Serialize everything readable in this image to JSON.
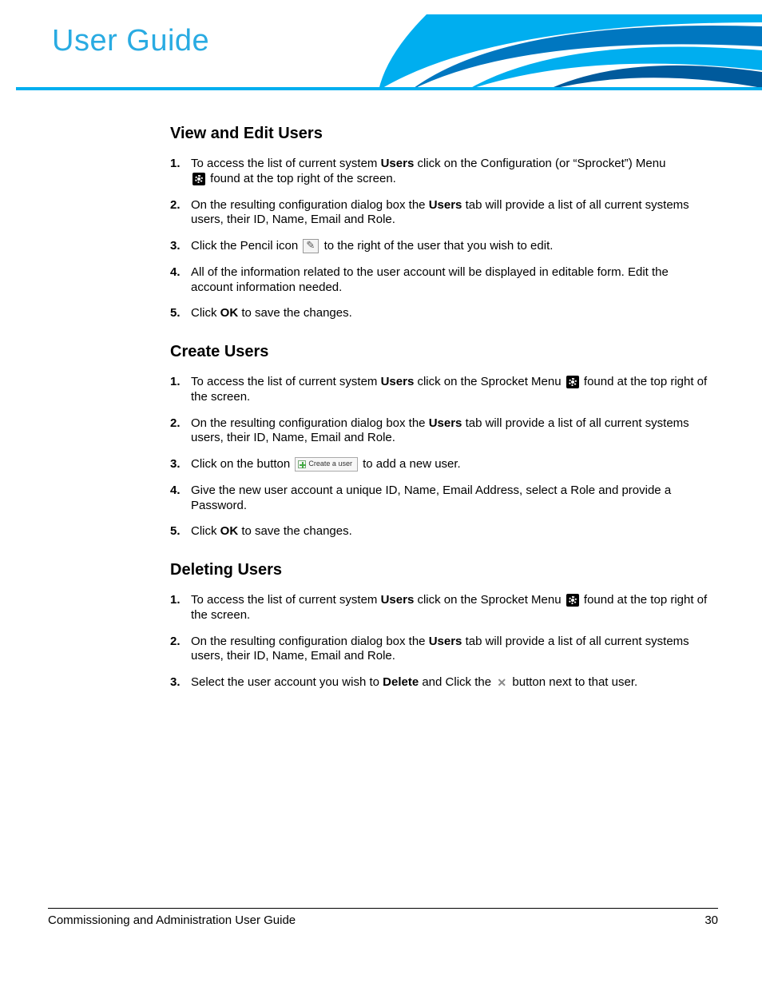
{
  "header": {
    "title": "User Guide"
  },
  "sections": {
    "view_edit": {
      "heading": "View and Edit Users",
      "items": {
        "n1": "1.",
        "n2": "2.",
        "n3": "3.",
        "n4": "4.",
        "n5": "5.",
        "i1a": "To access the list of current system ",
        "i1b": "Users",
        "i1c": " click on the Configuration (or “Sprocket”) Menu ",
        "i1d": " found at the top right of the screen.",
        "i2a": "On the resulting configuration dialog box the ",
        "i2b": "Users",
        "i2c": " tab will provide a list of all current systems users, their ID, Name, Email and Role.",
        "i3a": "Click the Pencil icon ",
        "i3b": " to the right of the user that you wish to edit.",
        "i4": "All of the information related to the user account will be displayed in editable form. Edit the account information needed.",
        "i5a": "Click ",
        "i5b": "OK",
        "i5c": " to save the changes."
      }
    },
    "create": {
      "heading": "Create Users",
      "items": {
        "n1": "1.",
        "n2": "2.",
        "n3": "3.",
        "n4": "4.",
        "n5": "5.",
        "i1a": "To access the list of current system ",
        "i1b": "Users",
        "i1c": " click on the Sprocket Menu ",
        "i1d": " found at the top right of the screen.",
        "i2a": "On the resulting configuration dialog box the ",
        "i2b": "Users",
        "i2c": " tab will provide a list of all current systems users, their ID, Name, Email and Role.",
        "i3a": "Click on the button ",
        "i3btn": "Create a user",
        "i3b": " to add a new user.",
        "i4": "Give the new user account a unique ID, Name, Email Address, select a Role and provide a Password.",
        "i5a": "Click ",
        "i5b": "OK",
        "i5c": " to save the changes."
      }
    },
    "delete": {
      "heading": "Deleting Users",
      "items": {
        "n1": "1.",
        "n2": "2.",
        "n3": "3.",
        "i1a": "To access the list of current system ",
        "i1b": "Users",
        "i1c": " click on the Sprocket Menu ",
        "i1d": " found at the top right of the screen.",
        "i2a": "On the resulting configuration dialog box the ",
        "i2b": "Users",
        "i2c": " tab will provide a list of all current systems users, their ID, Name, Email and Role.",
        "i3a": "Select the user account you wish to ",
        "i3b": "Delete",
        "i3c": " and Click the ",
        "i3d": " button next to that user."
      }
    }
  },
  "footer": {
    "left": "Commissioning and Administration User Guide",
    "right": "30"
  }
}
